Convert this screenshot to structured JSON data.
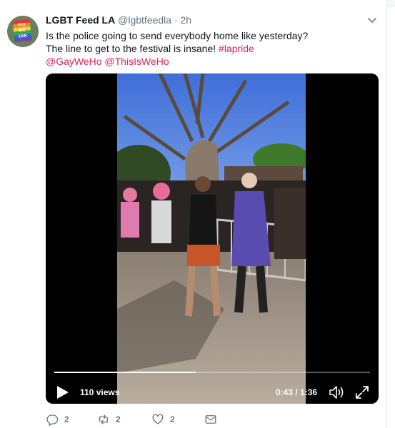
{
  "tweet": {
    "author_name": "LGBT Feed LA",
    "author_handle": "@lgbtfeedla",
    "separator": "·",
    "time": "2h",
    "text_line1": "Is the police going to send everybody home like yesterday?",
    "text_line2_plain": "The line to get to the festival is insane! ",
    "hashtag": "#lapride",
    "mention1": "@GayWeHo",
    "mention2": "@ThisIsWeHo",
    "avatar_sign_lines": [
      "YES",
      "WE",
      "CAN"
    ]
  },
  "video": {
    "views": "110 views",
    "timecode": "0:43 / 1:36",
    "progress_fraction": 0.448
  },
  "actions": {
    "reply_count": "2",
    "retweet_count": "2",
    "like_count": "2"
  },
  "colors": {
    "link": "#e0245e",
    "secondary_text": "#657786",
    "primary_text": "#14171a"
  },
  "icons": [
    "caret-down-icon",
    "play-icon",
    "volume-icon",
    "fullscreen-icon",
    "reply-icon",
    "retweet-icon",
    "like-icon",
    "message-icon"
  ]
}
